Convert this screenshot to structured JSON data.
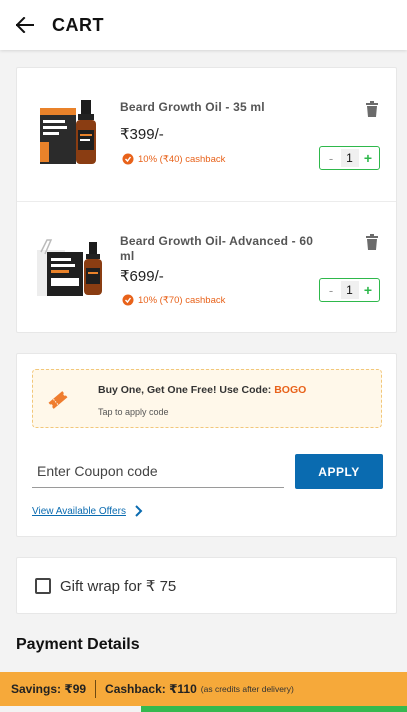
{
  "header": {
    "title": "CART"
  },
  "cart": {
    "items": [
      {
        "name": "Beard Growth Oil - 35 ml",
        "price": "₹399/-",
        "cashback": "10% (₹40) cashback",
        "qty_minus": "-",
        "quantity": "1",
        "qty_plus": "+"
      },
      {
        "name": "Beard Growth Oil- Advanced - 60 ml",
        "price": "₹699/-",
        "cashback": "10% (₹70) cashback",
        "qty_minus": "-",
        "quantity": "1",
        "qty_plus": "+"
      }
    ]
  },
  "offers": {
    "promo_title": "Buy One, Get One Free! Use Code: ",
    "promo_code": "BOGO",
    "promo_subtitle": "Tap to apply code",
    "coupon_placeholder": "Enter Coupon code",
    "apply_label": "APPLY",
    "view_offers_label": "View Available Offers"
  },
  "gift": {
    "label": "Gift wrap for ₹ 75",
    "checked": false
  },
  "payment": {
    "heading": "Payment Details"
  },
  "savings_bar": {
    "savings": "Savings: ₹99",
    "cashback": "Cashback: ₹110",
    "note": "(as credits after delivery)"
  },
  "colors": {
    "accent_blue": "#0a6bb0",
    "cashback_orange": "#e8621a",
    "qty_green": "#2eb84b",
    "savings_orange": "#f6a93a"
  },
  "icons": [
    "back-arrow-icon",
    "trash-icon",
    "cashback-badge-icon",
    "coupon-ticket-icon",
    "chevron-right-icon",
    "checkbox-icon"
  ]
}
